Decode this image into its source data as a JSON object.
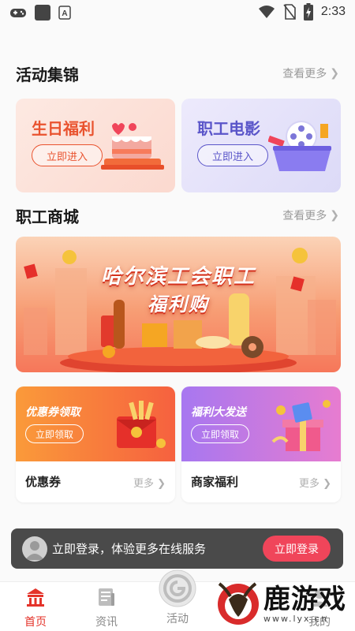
{
  "status_bar": {
    "time": "2:33"
  },
  "sections": {
    "activities": {
      "title": "活动集锦",
      "more": "查看更多"
    },
    "mall": {
      "title": "职工商城",
      "more": "查看更多"
    }
  },
  "activity_cards": [
    {
      "title": "生日福利",
      "button": "立即进入",
      "title_color": "#e9532f",
      "bg": "#fde6df"
    },
    {
      "title": "职工电影",
      "button": "立即进入",
      "title_color": "#5a55c9",
      "bg": "#e9e8fb"
    }
  ],
  "banner": {
    "line1": "哈尔滨工会职工",
    "line2": "福利购"
  },
  "promos": [
    {
      "title": "优惠券领取",
      "button": "立即领取",
      "label": "优惠券",
      "more": "更多"
    },
    {
      "title": "福利大发送",
      "button": "立即领取",
      "label": "商家福利",
      "more": "更多"
    }
  ],
  "login_bar": {
    "text": "立即登录，体验更多在线服务",
    "button": "立即登录"
  },
  "tabbar": [
    {
      "label": "首页",
      "icon": "home-icon",
      "active": true
    },
    {
      "label": "资讯",
      "icon": "news-icon",
      "active": false
    },
    {
      "label": "活动",
      "icon": "activity-icon",
      "active": false
    },
    {
      "label": "我的",
      "icon": "profile-icon",
      "active": false
    }
  ],
  "watermark": {
    "text": "鹿游戏",
    "sub": "www.lyx.cn"
  },
  "colors": {
    "accent": "#e4332a",
    "login_button": "#f0455a"
  }
}
